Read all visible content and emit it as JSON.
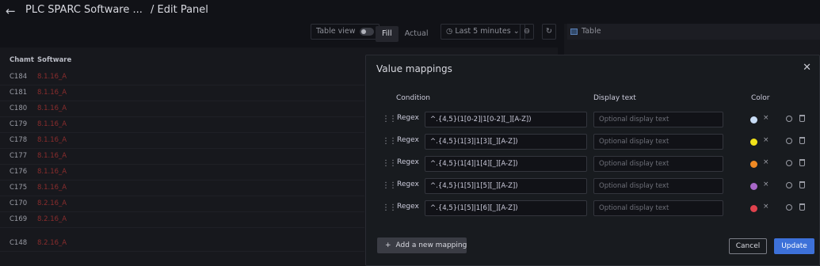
{
  "header": {
    "back_icon": "arrow-left-icon",
    "dashboard_title": "PLC SPARC Software ...",
    "page_title": "/ Edit Panel"
  },
  "toolbar": {
    "table_view_label": "Table view",
    "fill_label": "Fill",
    "actual_label": "Actual",
    "time_range_label": "Last 5 minutes",
    "zoom_out_icon": "zoom-out-icon",
    "refresh_icon": "refresh-icon",
    "viz_label": "Table"
  },
  "table": {
    "headers": [
      "Chamt",
      "Software"
    ],
    "rows": [
      [
        "C184",
        "8.1.16_A"
      ],
      [
        "C181",
        "8.1.16_A"
      ],
      [
        "C180",
        "8.1.16_A"
      ],
      [
        "C179",
        "8.1.16_A"
      ],
      [
        "C178",
        "8.1.16_A"
      ],
      [
        "C177",
        "8.1.16_A"
      ],
      [
        "C176",
        "8.1.16_A"
      ],
      [
        "C175",
        "8.1.16_A"
      ],
      [
        "C170",
        "8.2.16_A"
      ],
      [
        "C169",
        "8.2.16_A"
      ],
      [
        "C148",
        "8.2.16_A"
      ]
    ],
    "software_color": "#8a2d2d"
  },
  "modal": {
    "title": "Value mappings",
    "close_icon": "close-icon",
    "columns": {
      "condition": "Condition",
      "display_text": "Display text",
      "color": "Color"
    },
    "mappings": [
      {
        "type": "Regex",
        "pattern": "^.{4,5}(1[0-2]|1[0-2][_][A-Z])",
        "display": "",
        "placeholder": "Optional display text",
        "color": "#c8dcf5"
      },
      {
        "type": "Regex",
        "pattern": "^.{4,5}(1[3]|1[3][_][A-Z])",
        "display": "",
        "placeholder": "Optional display text",
        "color": "#f2e219"
      },
      {
        "type": "Regex",
        "pattern": "^.{4,5}(1[4]|1[4][_][A-Z])",
        "display": "",
        "placeholder": "Optional display text",
        "color": "#f08a24"
      },
      {
        "type": "Regex",
        "pattern": "^.{4,5}(1[5]|1[5][_][A-Z])",
        "display": "",
        "placeholder": "Optional display text",
        "color": "#a868c8"
      },
      {
        "type": "Regex",
        "pattern": "^.{4,5}(1[5]|1[6][_][A-Z])",
        "display": "",
        "placeholder": "Optional display text",
        "color": "#e0424d"
      }
    ],
    "add_label": "Add a new mapping",
    "cancel_label": "Cancel",
    "update_label": "Update"
  }
}
